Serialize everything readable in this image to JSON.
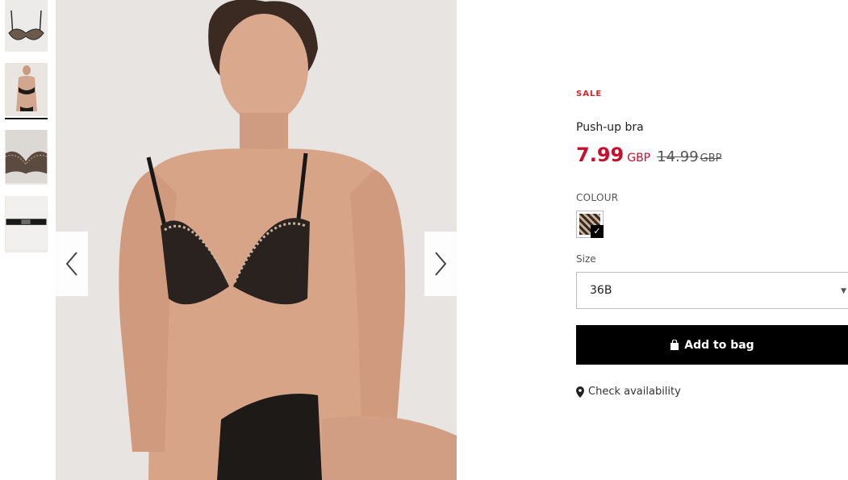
{
  "product": {
    "sale_label": "SALE",
    "name": "Push-up bra",
    "price": "7.99",
    "currency": "GBP",
    "old_price": "14.99",
    "old_currency": "GBP"
  },
  "colour": {
    "label": "COLOUR",
    "selected": true
  },
  "size": {
    "label": "Size",
    "selected_value": "36B"
  },
  "actions": {
    "add_to_bag": "Add to bag",
    "check_availability": "Check availability"
  },
  "gallery": {
    "active_thumbnail": 2,
    "icons": {
      "prev": "chevron-left-icon",
      "next": "chevron-right-icon",
      "bag": "shopping-bag-icon",
      "location": "map-pin-icon"
    }
  },
  "colors": {
    "sale_red": "#c8102e",
    "button_bg": "#000000"
  }
}
